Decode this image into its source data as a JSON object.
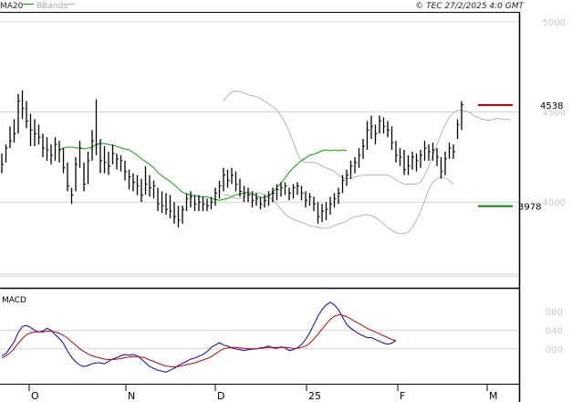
{
  "header": {
    "legend_ma": "MA20",
    "legend_bb": "BBands",
    "copyright": "© TEC 27/2/2025 4:0 GMT"
  },
  "colors": {
    "ma": "#00aa00",
    "bands": "#b4b4b4",
    "bar": "#000000",
    "resistance": "#cc0000",
    "support": "#008800",
    "macd": "#0000dd",
    "signal": "#cc0000",
    "grid": "#d6d6d6"
  },
  "chart_data": [
    {
      "type": "line",
      "title": "",
      "x_tick_labels": [
        "O",
        "N",
        "D",
        "25",
        "F",
        "M"
      ],
      "y_tick_labels": [
        "5000",
        "4500",
        "4000"
      ],
      "y_ticks": [
        5000,
        4500,
        4000
      ],
      "ylim": [
        3530,
        5050
      ],
      "resistance": {
        "value": 4538,
        "label": "4538"
      },
      "support": {
        "value": 3978,
        "label": "3978"
      },
      "price_bars": [
        {
          "h": 4270,
          "l": 4160,
          "c": 4210
        },
        {
          "h": 4320,
          "l": 4220,
          "c": 4300
        },
        {
          "h": 4420,
          "l": 4300,
          "c": 4340
        },
        {
          "h": 4460,
          "l": 4330,
          "c": 4380
        },
        {
          "h": 4600,
          "l": 4380,
          "c": 4560
        },
        {
          "h": 4620,
          "l": 4460,
          "c": 4520
        },
        {
          "h": 4560,
          "l": 4410,
          "c": 4450
        },
        {
          "h": 4490,
          "l": 4310,
          "c": 4400
        },
        {
          "h": 4460,
          "l": 4310,
          "c": 4380
        },
        {
          "h": 4430,
          "l": 4320,
          "c": 4360
        },
        {
          "h": 4380,
          "l": 4250,
          "c": 4300
        },
        {
          "h": 4360,
          "l": 4230,
          "c": 4290
        },
        {
          "h": 4320,
          "l": 4210,
          "c": 4260
        },
        {
          "h": 4360,
          "l": 4230,
          "c": 4320
        },
        {
          "h": 4340,
          "l": 4220,
          "c": 4290
        },
        {
          "h": 4300,
          "l": 4160,
          "c": 4190
        },
        {
          "h": 4220,
          "l": 4060,
          "c": 4090
        },
        {
          "h": 4080,
          "l": 3990,
          "c": 4040
        },
        {
          "h": 4250,
          "l": 4060,
          "c": 4210
        },
        {
          "h": 4340,
          "l": 4190,
          "c": 4300
        },
        {
          "h": 4220,
          "l": 4060,
          "c": 4100
        },
        {
          "h": 4280,
          "l": 4100,
          "c": 4230
        },
        {
          "h": 4400,
          "l": 4230,
          "c": 4340
        },
        {
          "h": 4570,
          "l": 4260,
          "c": 4320
        },
        {
          "h": 4350,
          "l": 4160,
          "c": 4230
        },
        {
          "h": 4310,
          "l": 4160,
          "c": 4220
        },
        {
          "h": 4280,
          "l": 4150,
          "c": 4200
        },
        {
          "h": 4320,
          "l": 4210,
          "c": 4270
        },
        {
          "h": 4270,
          "l": 4180,
          "c": 4240
        },
        {
          "h": 4260,
          "l": 4170,
          "c": 4230
        },
        {
          "h": 4230,
          "l": 4120,
          "c": 4170
        },
        {
          "h": 4180,
          "l": 4070,
          "c": 4140
        },
        {
          "h": 4160,
          "l": 4060,
          "c": 4110
        },
        {
          "h": 4150,
          "l": 4040,
          "c": 4090
        },
        {
          "h": 4130,
          "l": 4000,
          "c": 4040
        },
        {
          "h": 4200,
          "l": 4040,
          "c": 4100
        },
        {
          "h": 4150,
          "l": 4030,
          "c": 4080
        },
        {
          "h": 4120,
          "l": 4020,
          "c": 4090
        },
        {
          "h": 4080,
          "l": 3950,
          "c": 3990
        },
        {
          "h": 4060,
          "l": 3940,
          "c": 3980
        },
        {
          "h": 4050,
          "l": 3930,
          "c": 3960
        },
        {
          "h": 4040,
          "l": 3910,
          "c": 3950
        },
        {
          "h": 4000,
          "l": 3880,
          "c": 3920
        },
        {
          "h": 3980,
          "l": 3860,
          "c": 3900
        },
        {
          "h": 3980,
          "l": 3880,
          "c": 3960
        },
        {
          "h": 4050,
          "l": 3950,
          "c": 4020
        },
        {
          "h": 4060,
          "l": 3970,
          "c": 4030
        },
        {
          "h": 4040,
          "l": 3950,
          "c": 3990
        },
        {
          "h": 4040,
          "l": 3950,
          "c": 4000
        },
        {
          "h": 4030,
          "l": 3950,
          "c": 3990
        },
        {
          "h": 4020,
          "l": 3950,
          "c": 3980
        },
        {
          "h": 4030,
          "l": 3960,
          "c": 4000
        },
        {
          "h": 4080,
          "l": 3980,
          "c": 4050
        },
        {
          "h": 4120,
          "l": 4020,
          "c": 4090
        },
        {
          "h": 4190,
          "l": 4060,
          "c": 4150
        },
        {
          "h": 4180,
          "l": 4080,
          "c": 4120
        },
        {
          "h": 4190,
          "l": 4100,
          "c": 4150
        },
        {
          "h": 4170,
          "l": 4060,
          "c": 4100
        },
        {
          "h": 4130,
          "l": 4030,
          "c": 4060
        },
        {
          "h": 4090,
          "l": 4000,
          "c": 4050
        },
        {
          "h": 4080,
          "l": 4000,
          "c": 4040
        },
        {
          "h": 4060,
          "l": 3970,
          "c": 4010
        },
        {
          "h": 4050,
          "l": 3980,
          "c": 4020
        },
        {
          "h": 4030,
          "l": 3960,
          "c": 3990
        },
        {
          "h": 4040,
          "l": 3970,
          "c": 4010
        },
        {
          "h": 4060,
          "l": 3980,
          "c": 4040
        },
        {
          "h": 4080,
          "l": 4000,
          "c": 4050
        },
        {
          "h": 4100,
          "l": 4010,
          "c": 4070
        },
        {
          "h": 4110,
          "l": 4030,
          "c": 4080
        },
        {
          "h": 4110,
          "l": 4040,
          "c": 4090
        },
        {
          "h": 4080,
          "l": 4010,
          "c": 4050
        },
        {
          "h": 4100,
          "l": 4020,
          "c": 4080
        },
        {
          "h": 4110,
          "l": 4040,
          "c": 4090
        },
        {
          "h": 4090,
          "l": 4010,
          "c": 4050
        },
        {
          "h": 4060,
          "l": 3970,
          "c": 4010
        },
        {
          "h": 4050,
          "l": 3980,
          "c": 4030
        },
        {
          "h": 4030,
          "l": 3950,
          "c": 3990
        },
        {
          "h": 4000,
          "l": 3880,
          "c": 3920
        },
        {
          "h": 3990,
          "l": 3890,
          "c": 3950
        },
        {
          "h": 4000,
          "l": 3900,
          "c": 3960
        },
        {
          "h": 4030,
          "l": 3930,
          "c": 3990
        },
        {
          "h": 4050,
          "l": 3970,
          "c": 4020
        },
        {
          "h": 4080,
          "l": 3990,
          "c": 4050
        },
        {
          "h": 4150,
          "l": 4050,
          "c": 4120
        },
        {
          "h": 4180,
          "l": 4090,
          "c": 4150
        },
        {
          "h": 4230,
          "l": 4130,
          "c": 4200
        },
        {
          "h": 4250,
          "l": 4160,
          "c": 4220
        },
        {
          "h": 4300,
          "l": 4190,
          "c": 4260
        },
        {
          "h": 4350,
          "l": 4240,
          "c": 4310
        },
        {
          "h": 4450,
          "l": 4290,
          "c": 4400
        },
        {
          "h": 4480,
          "l": 4350,
          "c": 4420
        },
        {
          "h": 4430,
          "l": 4320,
          "c": 4380
        },
        {
          "h": 4480,
          "l": 4380,
          "c": 4450
        },
        {
          "h": 4470,
          "l": 4380,
          "c": 4420
        },
        {
          "h": 4450,
          "l": 4360,
          "c": 4400
        },
        {
          "h": 4420,
          "l": 4290,
          "c": 4330
        },
        {
          "h": 4340,
          "l": 4220,
          "c": 4260
        },
        {
          "h": 4300,
          "l": 4200,
          "c": 4250
        },
        {
          "h": 4290,
          "l": 4150,
          "c": 4180
        },
        {
          "h": 4260,
          "l": 4150,
          "c": 4200
        },
        {
          "h": 4280,
          "l": 4180,
          "c": 4250
        },
        {
          "h": 4270,
          "l": 4170,
          "c": 4230
        },
        {
          "h": 4290,
          "l": 4190,
          "c": 4260
        },
        {
          "h": 4340,
          "l": 4230,
          "c": 4300
        },
        {
          "h": 4320,
          "l": 4230,
          "c": 4280
        },
        {
          "h": 4330,
          "l": 4230,
          "c": 4290
        },
        {
          "h": 4300,
          "l": 4200,
          "c": 4250
        },
        {
          "h": 4250,
          "l": 4130,
          "c": 4170
        },
        {
          "h": 4280,
          "l": 4150,
          "c": 4240
        },
        {
          "h": 4330,
          "l": 4240,
          "c": 4300
        },
        {
          "h": 4320,
          "l": 4240,
          "c": 4280
        },
        {
          "h": 4460,
          "l": 4350,
          "c": 4430
        },
        {
          "h": 4560,
          "l": 4400,
          "c": 4540
        }
      ],
      "ma20": [
        4290,
        4300,
        4305,
        4305,
        4300,
        4300,
        4295,
        4300,
        4305,
        4320,
        4325,
        4325,
        4320,
        4315,
        4310,
        4300,
        4295,
        4290,
        4275,
        4260,
        4240,
        4225,
        4210,
        4190,
        4165,
        4145,
        4130,
        4115,
        4095,
        4075,
        4055,
        4045,
        4040,
        4035,
        4030,
        4030,
        4030,
        4020,
        4015,
        4010,
        4015,
        4020,
        4030,
        4040,
        4045,
        4050,
        4055,
        4045,
        4035,
        4025,
        4025,
        4035,
        4055,
        4080,
        4105,
        4135,
        4165,
        4190,
        4210,
        4230,
        4245,
        4260,
        4265,
        4275,
        4285,
        4290,
        4285,
        4290,
        4285,
        4290,
        4285
      ],
      "bb_upper": [
        4560,
        4590,
        4610,
        4615,
        4615,
        4605,
        4595,
        4590,
        4585,
        4575,
        4560,
        4545,
        4530,
        4510,
        4480,
        4440,
        4390,
        4330,
        4270,
        4230,
        4220,
        4220,
        4220,
        4215,
        4200,
        4190,
        4180,
        4170,
        4150,
        4135,
        4130,
        4130,
        4140,
        4145,
        4150,
        4150,
        4150,
        4150,
        4150,
        4150,
        4150,
        4140,
        4125,
        4110,
        4100,
        4100,
        4100,
        4100,
        4110,
        4150,
        4200,
        4260,
        4320,
        4380,
        4430,
        4470,
        4495,
        4510,
        4510,
        4505,
        4495,
        4480,
        4470,
        4460,
        4455,
        4455,
        4460,
        4465,
        4460,
        4460,
        4455
      ],
      "bb_lower": [
        4040,
        4040,
        4030,
        4020,
        4020,
        4030,
        4040,
        4045,
        4050,
        4050,
        4040,
        4030,
        4010,
        3990,
        3960,
        3935,
        3915,
        3905,
        3895,
        3890,
        3880,
        3870,
        3865,
        3860,
        3855,
        3855,
        3860,
        3870,
        3880,
        3885,
        3895,
        3910,
        3920,
        3920,
        3930,
        3930,
        3925,
        3915,
        3900,
        3880,
        3860,
        3845,
        3830,
        3825,
        3825,
        3835,
        3860,
        3900,
        3950,
        4010,
        4070,
        4110,
        4130,
        4140,
        4135,
        4120,
        4100
      ],
      "ma20_start_index": 14,
      "bb_start_index": 54
    },
    {
      "type": "line",
      "title": "MACD",
      "y_tick_labels": [
        "080",
        "040",
        "000"
      ],
      "y_ticks": [
        80,
        40,
        0
      ],
      "ylim": [
        -75,
        125
      ],
      "series": [
        {
          "name": "",
          "values": [
            -15,
            -10,
            2,
            15,
            35,
            48,
            50,
            46,
            40,
            36,
            38,
            44,
            40,
            30,
            22,
            12,
            -5,
            -18,
            -28,
            -35,
            -38,
            -36,
            -32,
            -30,
            -30,
            -32,
            -27,
            -22,
            -19,
            -15,
            -12,
            -14,
            -12,
            -15,
            -22,
            -30,
            -38,
            -42,
            -46,
            -48,
            -50,
            -46,
            -42,
            -36,
            -31,
            -27,
            -22,
            -20,
            -16,
            -12,
            -6,
            3,
            8,
            13,
            8,
            6,
            2,
            0,
            -2,
            -4,
            -2,
            -1,
            0,
            2,
            3,
            6,
            2,
            1,
            4,
            2,
            -4,
            -2,
            2,
            9,
            20,
            34,
            52,
            70,
            84,
            94,
            100,
            94,
            84,
            68,
            52,
            44,
            38,
            32,
            28,
            24,
            24,
            20,
            16,
            12,
            10,
            12,
            18
          ],
          "key": "macd"
        },
        {
          "name": "",
          "values": [
            -20,
            -15,
            -9,
            0,
            12,
            22,
            30,
            34,
            36,
            36,
            36,
            38,
            38,
            36,
            33,
            29,
            23,
            15,
            8,
            0,
            -6,
            -11,
            -15,
            -18,
            -20,
            -22,
            -23,
            -23,
            -22,
            -21,
            -19,
            -18,
            -17,
            -17,
            -18,
            -20,
            -24,
            -27,
            -31,
            -34,
            -37,
            -38,
            -39,
            -38,
            -36,
            -34,
            -32,
            -30,
            -27,
            -24,
            -21,
            -17,
            -11,
            -5,
            0,
            2,
            3,
            3,
            2,
            1,
            0,
            0,
            0,
            1,
            2,
            3,
            3,
            3,
            3,
            3,
            2,
            1,
            1,
            3,
            6,
            12,
            21,
            31,
            42,
            53,
            63,
            70,
            73,
            72,
            69,
            64,
            59,
            54,
            49,
            44,
            40,
            36,
            32,
            28,
            24,
            20,
            18
          ],
          "key": "signal"
        }
      ]
    }
  ]
}
